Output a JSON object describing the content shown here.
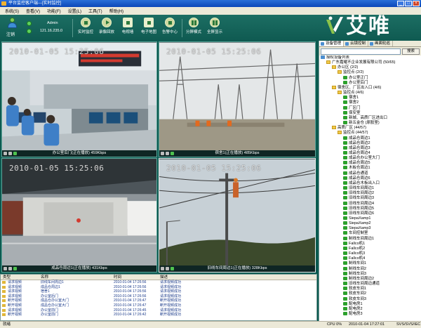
{
  "window": {
    "title": "平台监控客户端---[实时监控]",
    "controls": [
      "_",
      "□",
      "×"
    ]
  },
  "menu": [
    "系统(S)",
    "查看(V)",
    "功能(F)",
    "设置(L)",
    "工具(T)",
    "帮助(H)"
  ],
  "toolbar": {
    "logout_label": "注销",
    "user_name": "Admin",
    "user_ip": "121.16.235.0",
    "buttons": [
      {
        "label": "实时监控",
        "icon": "camera-icon"
      },
      {
        "label": "录像回放",
        "icon": "play-icon"
      },
      {
        "label": "电视墙",
        "icon": "tv-wall-icon"
      },
      {
        "label": "电子地图",
        "icon": "map-icon"
      },
      {
        "label": "告警中心",
        "icon": "alarm-icon"
      },
      {
        "label": "分屏模式",
        "icon": "split-screen-icon"
      },
      {
        "label": "全屏显示",
        "icon": "fullscreen-icon"
      }
    ],
    "brand": "艾唯"
  },
  "videos": [
    {
      "timestamp": "2010-01-05 15:25:06",
      "caption": "办公室后门(正在播放)  459Kbps"
    },
    {
      "timestamp": "2010-01-05 15:25:06",
      "caption": "宿舍1(正在播放)  485Kbps"
    },
    {
      "timestamp": "2010-01-05 15:25:06",
      "caption": "成品仓周边1(正在播放)  431Kbps"
    },
    {
      "timestamp": "2010-01-05 15:25:06",
      "caption": "旧线车间周边1(正在播放)  328Kbps"
    }
  ],
  "log": {
    "headers": [
      "类型",
      "名称",
      "时间",
      "描述"
    ],
    "rows": [
      [
        "请求视频",
        "旧线车间周边1",
        "2010-01-04 17:26:56",
        "请求视频成功"
      ],
      [
        "请求视频",
        "成品仓周边1",
        "2010-01-04 17:26:56",
        "请求视频成功"
      ],
      [
        "请求视频",
        "宿舍1",
        "2010-01-04 17:26:56",
        "请求视频成功"
      ],
      [
        "请求视频",
        "办公室后门",
        "2010-01-04 17:26:56",
        "请求视频成功"
      ],
      [
        "断开视频",
        "成品仓办公室大门",
        "2010-01-04 17:26:47",
        "断开视频成功"
      ],
      [
        "断开视频",
        "成品仓办公室大门",
        "2010-01-04 17:26:47",
        "断开视频成功"
      ],
      [
        "请求视频",
        "办公室前门",
        "2010-01-04 17:26:45",
        "请求视频成功"
      ],
      [
        "断开视频",
        "办公室前门",
        "2010-01-04 17:26:42",
        "断开视频成功"
      ]
    ]
  },
  "panel": {
    "tabs": [
      "设备管理",
      "云镜控制",
      "画面轮巡"
    ],
    "search_button": "搜索",
    "tree": [
      {
        "text": "授权设备列表",
        "level": 0,
        "type": "root"
      },
      {
        "text": "广东嘉耀不企业发展有限公司 (50/65)",
        "level": 1,
        "type": "folder"
      },
      {
        "text": "办公区 (2/2)",
        "level": 2,
        "type": "folder"
      },
      {
        "text": "监控点 (2/2)",
        "level": 3,
        "type": "folder"
      },
      {
        "text": "办公室正门",
        "level": 4,
        "type": "cam"
      },
      {
        "text": "办公室后门",
        "level": 4,
        "type": "cam"
      },
      {
        "text": "宿舍区、厂区出入口 (4/6)",
        "level": 2,
        "type": "folder"
      },
      {
        "text": "监控点 (4/6)",
        "level": 3,
        "type": "folder"
      },
      {
        "text": "宿舍1",
        "level": 4,
        "type": "cam"
      },
      {
        "text": "宿舍2",
        "level": 4,
        "type": "cam"
      },
      {
        "text": "厂区门",
        "level": 4,
        "type": "cam"
      },
      {
        "text": "保安室",
        "level": 4,
        "type": "cam"
      },
      {
        "text": "新城、高质厂区进出口",
        "level": 4,
        "type": "cam"
      },
      {
        "text": "新五金仓 (原胶室)",
        "level": 4,
        "type": "cam"
      },
      {
        "text": "高质厂区 (44/57)",
        "level": 2,
        "type": "folder"
      },
      {
        "text": "监控点 (44/57)",
        "level": 3,
        "type": "folder"
      },
      {
        "text": "成品仓周边1",
        "level": 4,
        "type": "cam"
      },
      {
        "text": "成品仓周边2",
        "level": 4,
        "type": "cam"
      },
      {
        "text": "成品仓周边3",
        "level": 4,
        "type": "cam"
      },
      {
        "text": "成品仓周边4",
        "level": 4,
        "type": "cam"
      },
      {
        "text": "成品仓办公室大门",
        "level": 4,
        "type": "cam"
      },
      {
        "text": "成品仓周边5",
        "level": 4,
        "type": "cam"
      },
      {
        "text": "木板仓周边1",
        "level": 4,
        "type": "cam"
      },
      {
        "text": "成品仓通道",
        "level": 4,
        "type": "cam"
      },
      {
        "text": "成品仓周边6",
        "level": 4,
        "type": "cam"
      },
      {
        "text": "成品仓木板出入口",
        "level": 4,
        "type": "cam"
      },
      {
        "text": "旧线车间周边1",
        "level": 4,
        "type": "cam"
      },
      {
        "text": "旧线车间周边2",
        "level": 4,
        "type": "cam"
      },
      {
        "text": "旧线车间周边3",
        "level": 4,
        "type": "cam"
      },
      {
        "text": "旧线车间周边4",
        "level": 4,
        "type": "cam"
      },
      {
        "text": "旧线车间周边5",
        "level": 4,
        "type": "cam"
      },
      {
        "text": "旧线车间周边6",
        "level": 4,
        "type": "cam"
      },
      {
        "text": "SiepaXamp1",
        "level": 4,
        "type": "cam"
      },
      {
        "text": "SiepaXamp2",
        "level": 4,
        "type": "cam"
      },
      {
        "text": "SiepaXamp3",
        "level": 4,
        "type": "cam"
      },
      {
        "text": "车间控制室",
        "level": 4,
        "type": "cam"
      },
      {
        "text": "制线车间周边1",
        "level": 4,
        "type": "cam"
      },
      {
        "text": "Fallco机1",
        "level": 4,
        "type": "cam"
      },
      {
        "text": "Fallco机2",
        "level": 4,
        "type": "cam"
      },
      {
        "text": "Fallco机3",
        "level": 4,
        "type": "cam"
      },
      {
        "text": "Fallco机4",
        "level": 4,
        "type": "cam"
      },
      {
        "text": "制线车间1",
        "level": 4,
        "type": "cam"
      },
      {
        "text": "制线车间2",
        "level": 4,
        "type": "cam"
      },
      {
        "text": "制线车间3",
        "level": 4,
        "type": "cam"
      },
      {
        "text": "制线车间周边2",
        "level": 4,
        "type": "cam"
      },
      {
        "text": "旧线车间周边通道",
        "level": 4,
        "type": "cam"
      },
      {
        "text": "软皮车间1",
        "level": 4,
        "type": "cam"
      },
      {
        "text": "软皮车间2",
        "level": 4,
        "type": "cam"
      },
      {
        "text": "软皮车间3",
        "level": 4,
        "type": "cam"
      },
      {
        "text": "配电房1",
        "level": 4,
        "type": "cam"
      },
      {
        "text": "配电房2",
        "level": 4,
        "type": "cam"
      },
      {
        "text": "配电房3",
        "level": 4,
        "type": "cam"
      }
    ]
  },
  "statusbar": {
    "status": "就绪",
    "cpu": "CPU  0%",
    "datetime": "2010-01-04 17:27:01",
    "version": "SVS/SVS/IEC"
  }
}
